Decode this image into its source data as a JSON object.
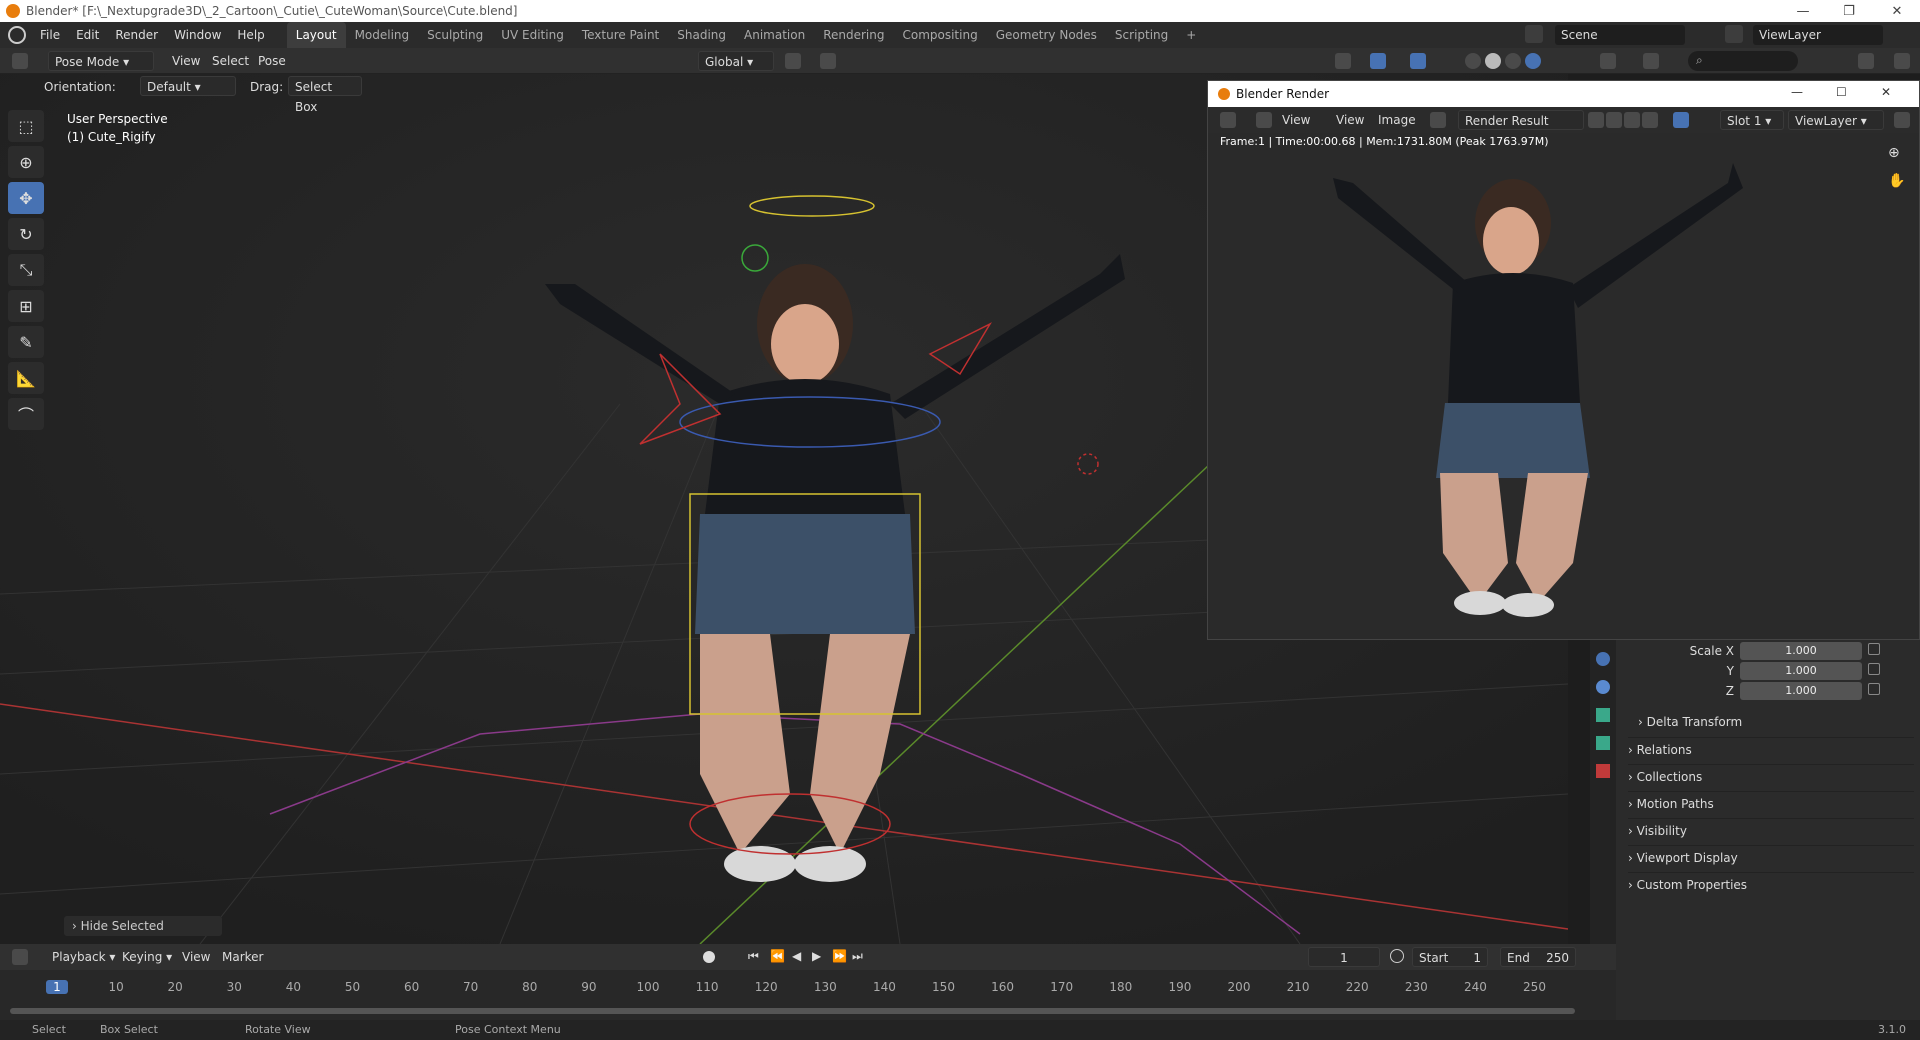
{
  "window": {
    "title": "Blender* [F:\\_Nextupgrade3D\\_2_Cartoon\\_Cutie\\_CuteWoman\\Source\\Cute.blend]"
  },
  "menu": {
    "items": [
      "File",
      "Edit",
      "Render",
      "Window",
      "Help"
    ]
  },
  "workspaces": [
    "Layout",
    "Modeling",
    "Sculpting",
    "UV Editing",
    "Texture Paint",
    "Shading",
    "Animation",
    "Rendering",
    "Compositing",
    "Geometry Nodes",
    "Scripting"
  ],
  "top_right": {
    "scene": "Scene",
    "view_layer": "ViewLayer"
  },
  "viewport_header": {
    "mode": "Pose Mode",
    "view": "View",
    "select": "Select",
    "pose": "Pose",
    "transform_orientation": "Global"
  },
  "tool_settings": {
    "orientation_label": "Orientation:",
    "orientation_value": "Default",
    "drag_label": "Drag:",
    "drag_value": "Select Box"
  },
  "viewport": {
    "perspective": "User Perspective",
    "object": "(1) Cute_Rigify",
    "last_op": "Hide Selected"
  },
  "render_window": {
    "title": "Blender Render",
    "view1": "View",
    "view2": "View",
    "image": "Image",
    "image_name": "Render Result",
    "slot": "Slot 1",
    "layer": "ViewLayer",
    "info": "Frame:1 | Time:00:00.68 | Mem:1731.80M (Peak 1763.97M)"
  },
  "properties": {
    "scale_x_label": "Scale X",
    "scale_y_label": "Y",
    "scale_z_label": "Z",
    "scale_x": "1.000",
    "scale_y": "1.000",
    "scale_z": "1.000",
    "sections": [
      "Delta Transform",
      "Relations",
      "Collections",
      "Motion Paths",
      "Visibility",
      "Viewport Display",
      "Custom Properties"
    ]
  },
  "timeline": {
    "playback": "Playback",
    "keying": "Keying",
    "view": "View",
    "marker": "Marker",
    "current_frame": "1",
    "start_label": "Start",
    "start": "1",
    "end_label": "End",
    "end": "250",
    "ticks": [
      "1",
      "10",
      "20",
      "30",
      "40",
      "50",
      "60",
      "70",
      "80",
      "90",
      "100",
      "110",
      "120",
      "130",
      "140",
      "150",
      "160",
      "170",
      "180",
      "190",
      "200",
      "210",
      "220",
      "230",
      "240",
      "250"
    ]
  },
  "status": {
    "select": "Select",
    "box_select": "Box Select",
    "rotate_view": "Rotate View",
    "context_menu": "Pose Context Menu",
    "version": "3.1.0"
  }
}
